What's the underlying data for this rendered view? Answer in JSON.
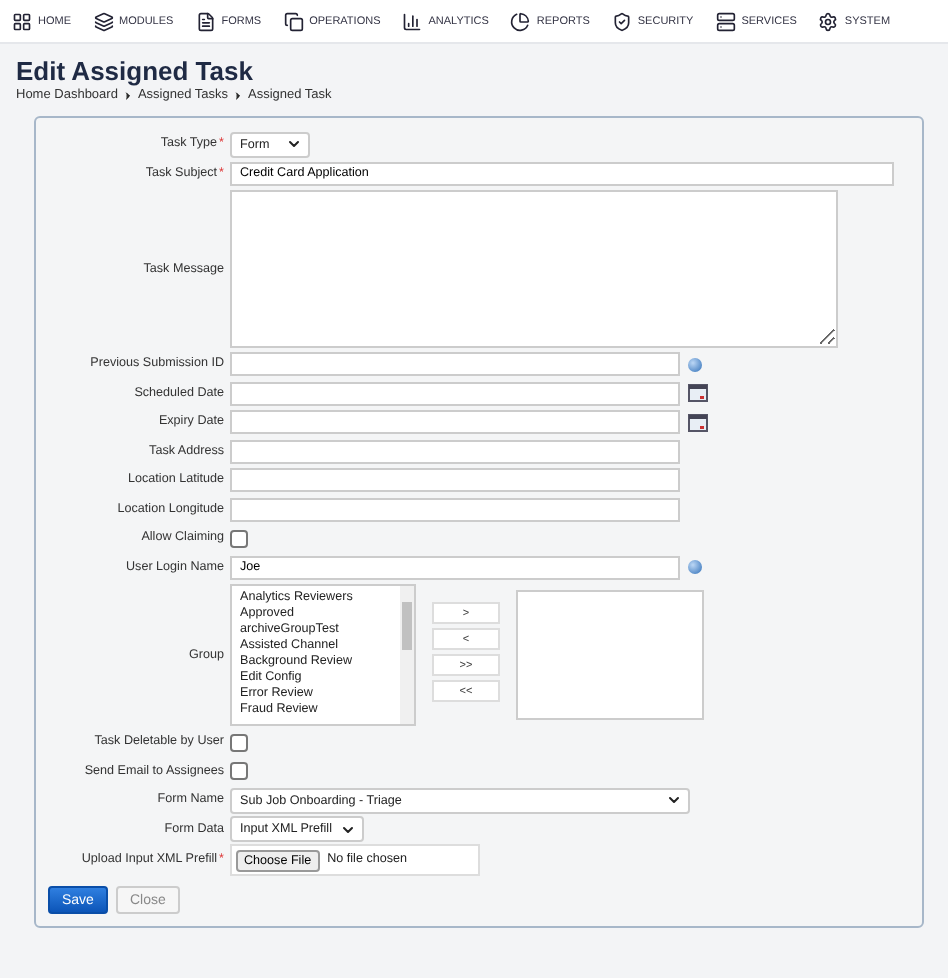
{
  "nav": [
    "HOME",
    "MODULES",
    "FORMS",
    "OPERATIONS",
    "ANALYTICS",
    "REPORTS",
    "SECURITY",
    "SERVICES",
    "SYSTEM"
  ],
  "page": {
    "title": "Edit Assigned Task",
    "breadcrumb": [
      "Home Dashboard",
      "Assigned Tasks",
      "Assigned Task"
    ]
  },
  "fields": [
    {
      "kind": "short-select",
      "label": "Task Type",
      "required": true,
      "value": "Form"
    },
    {
      "kind": "wide-text",
      "label": "Task Subject",
      "required": true,
      "value": "Credit Card Application"
    },
    {
      "kind": "textarea",
      "label": "Task Message",
      "required": false
    },
    {
      "kind": "lookup",
      "label": "Previous Submission ID",
      "required": false
    },
    {
      "kind": "date",
      "label": "Scheduled Date",
      "required": false
    },
    {
      "kind": "date",
      "label": "Expiry Date",
      "required": false
    },
    {
      "kind": "text",
      "label": "Task Address",
      "required": false
    },
    {
      "kind": "text",
      "label": "Location Latitude",
      "required": false
    },
    {
      "kind": "text",
      "label": "Location Longitude",
      "required": false
    },
    {
      "kind": "checkbox",
      "label": "Allow Claiming",
      "required": false,
      "checked": false
    },
    {
      "kind": "lookup",
      "label": "User Login Name",
      "required": false,
      "value": "Joe"
    },
    {
      "kind": "group",
      "label": "Group",
      "required": false,
      "options": [
        "Analytics Reviewers",
        "Approved",
        "archiveGroupTest",
        "Assisted Channel",
        "Background Review",
        "Edit Config",
        "Error Review",
        "Fraud Review"
      ],
      "buttons": [
        ">",
        "<",
        ">>",
        "<<"
      ]
    },
    {
      "kind": "checkbox",
      "label": "Task Deletable by User",
      "required": false,
      "checked": false
    },
    {
      "kind": "checkbox",
      "label": "Send Email to Assignees",
      "required": false,
      "checked": false
    },
    {
      "kind": "wide-select",
      "label": "Form Name",
      "required": false,
      "value": "Sub Job Onboarding - Triage"
    },
    {
      "kind": "select",
      "label": "Form Data",
      "required": false,
      "value": "Input XML Prefill"
    },
    {
      "kind": "file",
      "label": "Upload Input XML Prefill",
      "required": true,
      "button": "Choose File",
      "status": "No file chosen"
    }
  ],
  "required_marker": "*",
  "actions": [
    {
      "label": "Save",
      "primary": true
    },
    {
      "label": "Close",
      "primary": false
    }
  ]
}
